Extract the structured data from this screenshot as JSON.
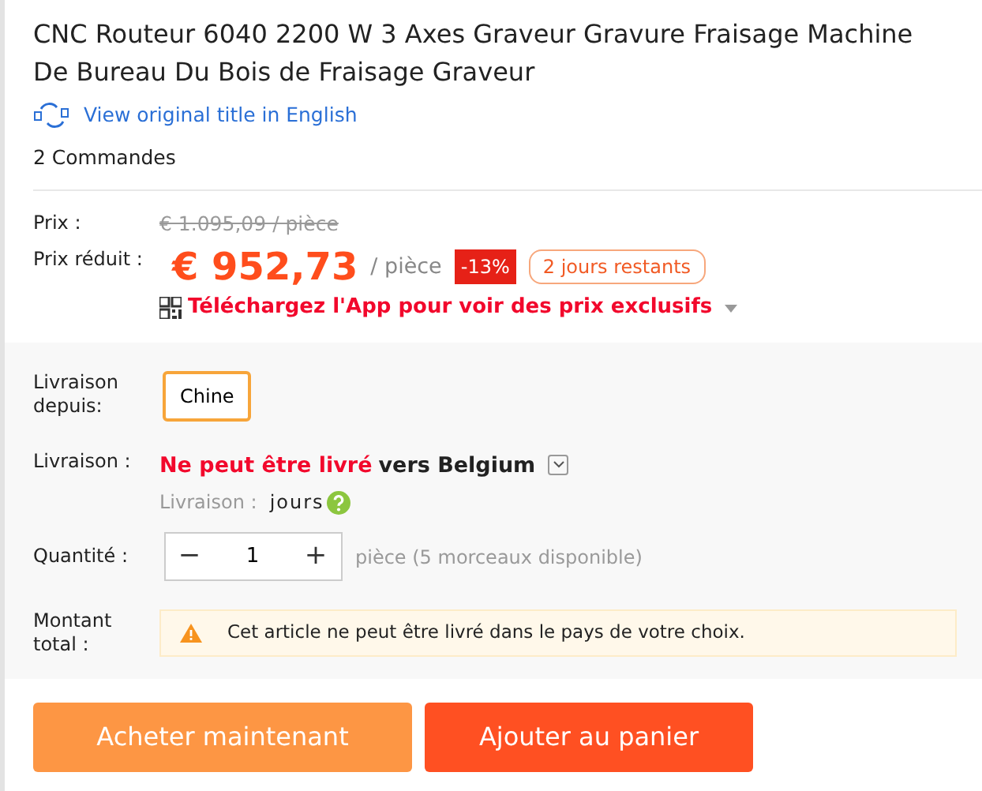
{
  "title": "CNC Routeur 6040 2200 W 3 Axes Graveur Gravure Fraisage Machine De Bureau Du Bois de Fraisage Graveur",
  "translate_link": "View original title in English",
  "orders": "2 Commandes",
  "price": {
    "label": "Prix :",
    "original": "€ 1.095,09 / pièce"
  },
  "sale": {
    "label": "Prix réduit :",
    "amount": "€ 952,73",
    "unit": "/ pièce",
    "discount": "-13%",
    "countdown": "2 jours restants"
  },
  "app_promo": "Téléchargez l'App pour voir des prix exclusifs",
  "ship_from": {
    "label": "Livraison depuis:",
    "options": [
      {
        "label": "Chine",
        "selected": true
      }
    ]
  },
  "shipping": {
    "label": "Livraison :",
    "status": "Ne peut être livré",
    "destination": "vers Belgium",
    "time_label": "Livraison :",
    "time_value": "jours"
  },
  "quantity": {
    "label": "Quantité :",
    "minus": "−",
    "value": "1",
    "plus": "+",
    "note": "pièce (5 morceaux disponible)"
  },
  "total": {
    "label": "Montant total :",
    "warning": "Cet article ne peut être livré dans le pays de votre choix."
  },
  "buttons": [
    {
      "label": "Acheter maintenant",
      "kind": "buy"
    },
    {
      "label": "Ajouter au panier",
      "kind": "cart"
    }
  ]
}
